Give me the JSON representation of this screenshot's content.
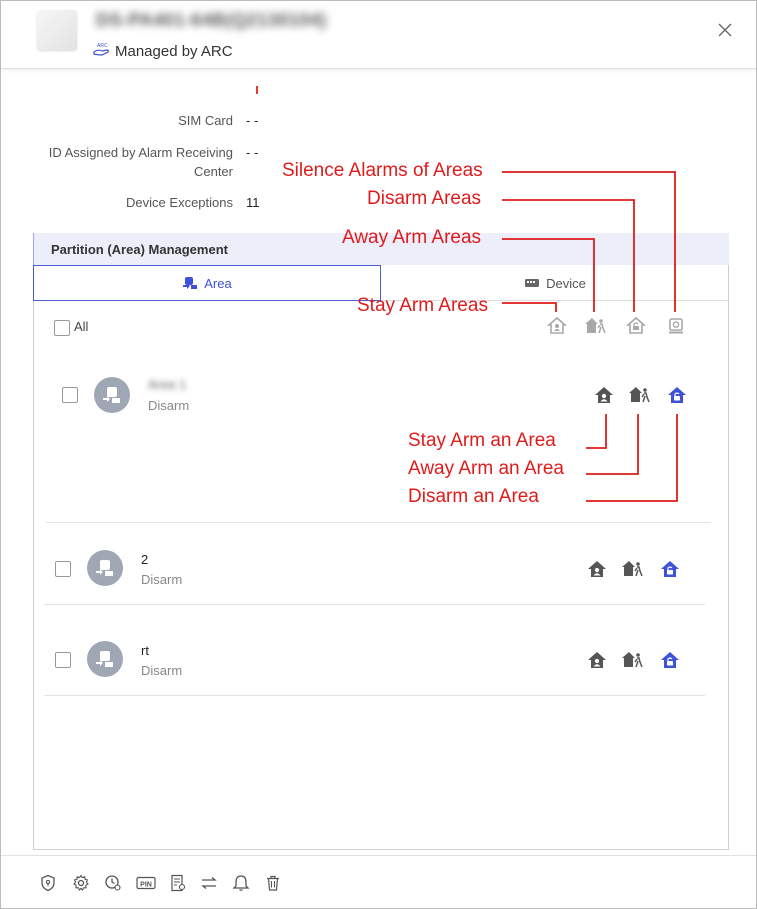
{
  "header": {
    "device_title": "DS-PA401-64B(Q2130104)",
    "managed_by": "Managed by ARC"
  },
  "info": {
    "sim_card_label": "SIM Card",
    "sim_card_value": "- -",
    "arc_id_label_line1": "ID Assigned by Alarm Receiving",
    "arc_id_label_line2": "Center",
    "arc_id_value": "- -",
    "device_exceptions_label": "Device Exceptions",
    "device_exceptions_value": "11"
  },
  "partition": {
    "title": "Partition (Area) Management",
    "tabs": [
      {
        "label": "Area",
        "active": true
      },
      {
        "label": "Device",
        "active": false
      }
    ],
    "select_all_label": "All",
    "areas": [
      {
        "name": "Area 1",
        "status": "Disarm"
      },
      {
        "name": "2",
        "status": "Disarm"
      },
      {
        "name": "rt",
        "status": "Disarm"
      }
    ]
  },
  "annotations": {
    "silence_alarms": "Silence Alarms of Areas",
    "disarm_areas": "Disarm Areas",
    "away_arm_areas": "Away Arm Areas",
    "stay_arm_areas": "Stay Arm Areas",
    "stay_arm_area": "Stay Arm an Area",
    "away_arm_area": "Away Arm an Area",
    "disarm_area": "Disarm an Area"
  },
  "footer_icons": [
    "shield-icon",
    "gear-icon",
    "clock-settings-icon",
    "pin-icon",
    "certificate-icon",
    "swap-icon",
    "bell-icon",
    "trash-icon"
  ],
  "colors": {
    "accent": "#3f51d6",
    "annotation": "#e01b1b",
    "icon_gray": "#555555",
    "icon_light": "#a8a8a8"
  }
}
